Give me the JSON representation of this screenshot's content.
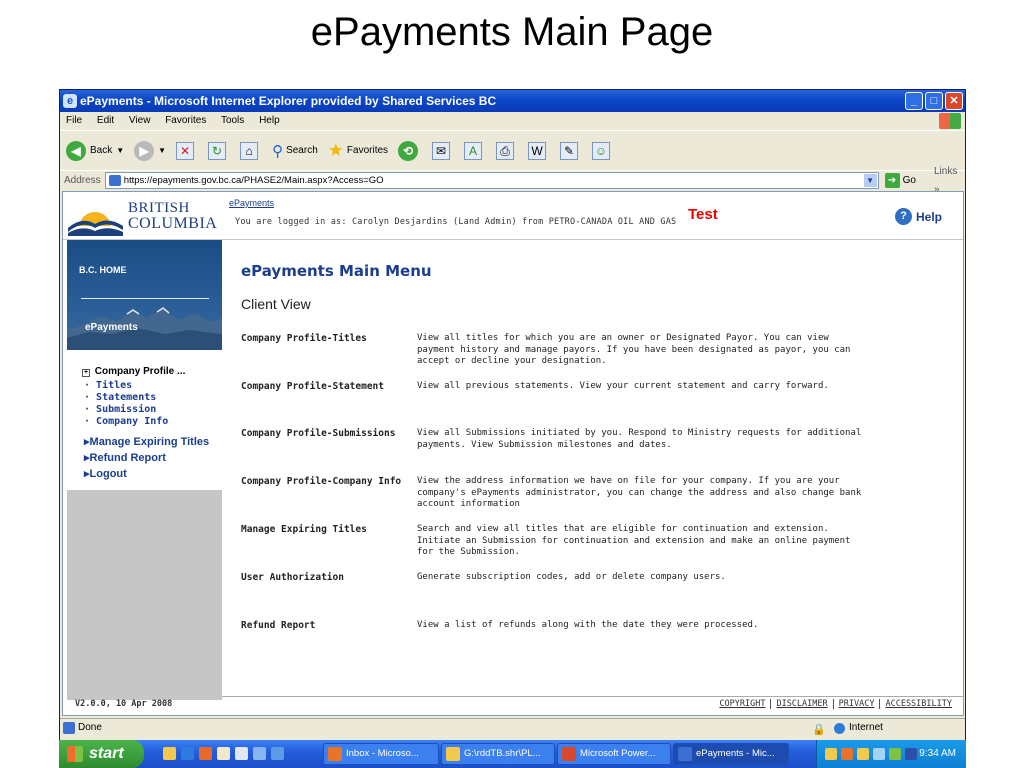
{
  "slide_title": "ePayments Main Page",
  "window": {
    "title": "ePayments - Microsoft Internet Explorer provided by Shared Services BC",
    "controls": [
      "_",
      "□",
      "✕"
    ]
  },
  "menu": [
    "File",
    "Edit",
    "View",
    "Favorites",
    "Tools",
    "Help"
  ],
  "toolbar": {
    "back": "Back",
    "search": "Search",
    "favorites": "Favorites"
  },
  "address": {
    "label": "Address",
    "url": "https://epayments.gov.bc.ca/PHASE2/Main.aspx?Access=GO",
    "go": "Go",
    "links": "Links »"
  },
  "page": {
    "logo": {
      "line1": "BRITISH",
      "line2": "COLUMBIA"
    },
    "breadcrumb": "ePayments",
    "logged_in": "You are logged in as: Carolyn Desjardins (Land Admin) from PETRO-CANADA OIL AND GAS",
    "env_badge": "Test",
    "help": "Help",
    "sidebar": {
      "home": "B.C. HOME",
      "section": "ePayments",
      "company_profile": "Company Profile ...",
      "sub_items": [
        "Titles",
        "Statements",
        "Submission",
        "Company Info"
      ],
      "main_items": [
        "Manage Expiring Titles",
        "Refund Report",
        "Logout"
      ]
    },
    "main_title": "ePayments Main Menu",
    "view_title": "Client View",
    "rows": [
      {
        "label": "Company Profile-Titles",
        "desc": "View all titles for which you are an owner or Designated Payor. You can view payment history and manage payors. If you have been designated as payor, you can accept or decline your designation."
      },
      {
        "label": "Company Profile-Statement",
        "desc": "View all previous statements. View your current statement and carry forward."
      },
      {
        "label": "Company Profile-Submissions",
        "desc": "View all Submissions initiated by you. Respond to Ministry requests for additional payments. View Submission milestones and dates."
      },
      {
        "label": "Company Profile-Company Info",
        "desc": "View the address information we have on file for your company. If you are your company's ePayments administrator, you can change the address and also change bank account information"
      },
      {
        "label": "Manage Expiring Titles",
        "desc": "Search and view all titles that are eligible for continuation and extension. Initiate an Submission for continuation and extension and make an online payment for the Submission."
      },
      {
        "label": "User Authorization",
        "desc": "Generate subscription codes, add or delete company users."
      },
      {
        "label": "Refund Report",
        "desc": "View a list of refunds along with the date they were processed."
      }
    ],
    "version": "V2.0.0, 10 Apr 2008",
    "footer_links": [
      "COPYRIGHT",
      "DISCLAIMER",
      "PRIVACY",
      "ACCESSIBILITY"
    ]
  },
  "status": {
    "text": "Done",
    "zone": "Internet"
  },
  "taskbar": {
    "start": "start",
    "tasks": [
      "Inbox - Microso...",
      "G:\\rddTB.shr\\PL...",
      "Microsoft Power...",
      "ePayments - Mic..."
    ],
    "clock": "9:34 AM"
  },
  "colors": {
    "accent": "#1a3d8f",
    "test_badge": "#e00000",
    "sidebar": "#1b4c84"
  }
}
